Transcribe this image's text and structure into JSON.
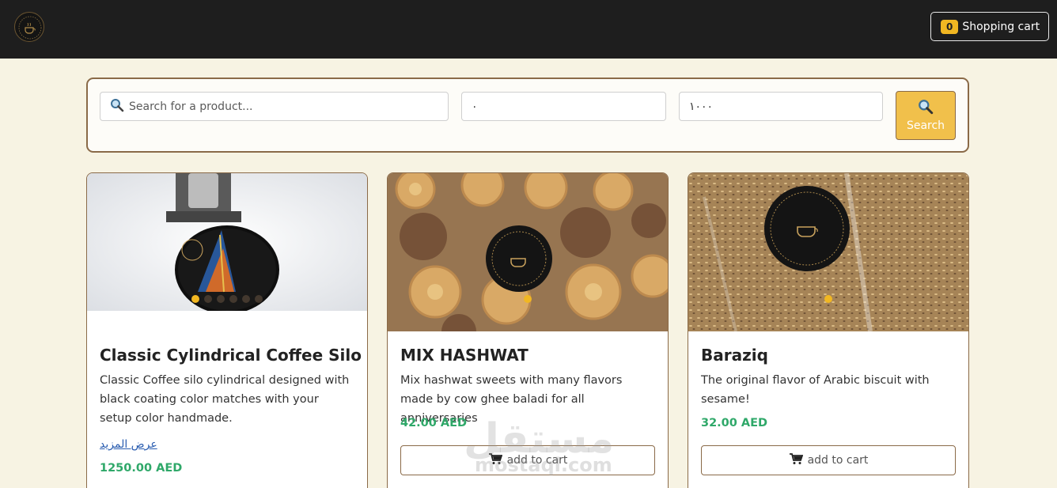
{
  "header": {
    "cart_count": "0",
    "cart_label": "Shopping cart",
    "colors": {
      "bar": "#1e1e1e",
      "accent": "#f1b722"
    }
  },
  "filters": {
    "search_placeholder": "Search for a product...",
    "min_price": "٠",
    "max_price": "١٠٠٠",
    "search_button_label": "Search",
    "search_icon": "magnifier-icon"
  },
  "products": [
    {
      "title": "Classic Cylindrical Coffee Silo",
      "description": "Classic Coffee silo cylindrical designed with black coating color matches with your setup color handmade.",
      "more_link": "عرض المزيد",
      "price": "1250.00 AED",
      "image_dots": 6
    },
    {
      "title": "MIX HASHWAT",
      "description": "Mix hashwat sweets with many flavors made by cow ghee baladi for all anniversaries",
      "price": "42.00 AED",
      "add_to_cart": "add to cart",
      "image_dots": 1
    },
    {
      "title": "Baraziq",
      "description": "The original flavor of Arabic biscuit with sesame!",
      "price": "32.00 AED",
      "add_to_cart": "add to cart",
      "image_dots": 1
    }
  ],
  "watermark": {
    "text": "مستقل",
    "url": "mostaql.com"
  }
}
